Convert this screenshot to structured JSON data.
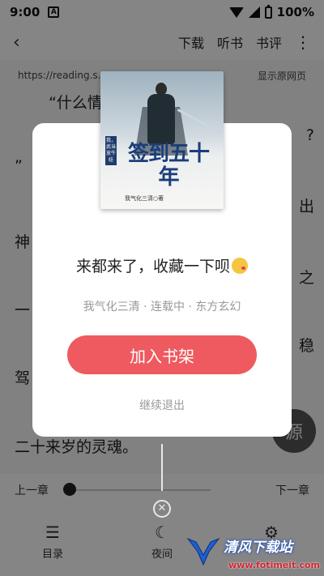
{
  "status_bar": {
    "time": "9:00",
    "notification_glyph": "A",
    "battery": "100%"
  },
  "top_bar": {
    "back_icon": "‹",
    "actions": [
      "下载",
      "听书",
      "书评"
    ],
    "more_icon": "⋮"
  },
  "url_bar": {
    "url": "https://reading.s...r...",
    "show_original": "显示原网页"
  },
  "reader_text": {
    "line1": "“什么情",
    "line1_right": "?",
    "line2": "”",
    "line3": "神",
    "line3_right": "出",
    "line4": "一",
    "line4_right": "之",
    "line5": "驾",
    "line5_right": "稳",
    "line6": "二十来岁的灵魂。"
  },
  "source_fab": "源",
  "bottom_bar": {
    "prev_chapter": "上一章",
    "next_chapter": "下一章",
    "progress_fraction": 0.0,
    "tabs": [
      {
        "label": "目录",
        "icon": "menu-icon",
        "glyph": "☰"
      },
      {
        "label": "夜间",
        "icon": "moon-icon",
        "glyph": "☾"
      },
      {
        "label": "",
        "icon": "settings-icon",
        "glyph": "⚙"
      }
    ]
  },
  "modal": {
    "cover": {
      "series_tag": "我，武当放牛娃",
      "title": "签到五十年",
      "author_line": "我气化三清○著"
    },
    "title": "来都来了，收藏一下呗",
    "emoji": "kissing-face-emoji",
    "meta": "我气化三清 · 连载中 · 东方玄幻",
    "add_button": "加入书架",
    "exit_link": "继续退出",
    "close_icon": "✕"
  },
  "watermark": {
    "name": "清风下载站",
    "url": "www.fotimeit.com"
  },
  "colors": {
    "accent": "#ee5a5f",
    "overlay": "rgba(0,0,0,0.48)",
    "cover_title": "#1a3e79"
  }
}
